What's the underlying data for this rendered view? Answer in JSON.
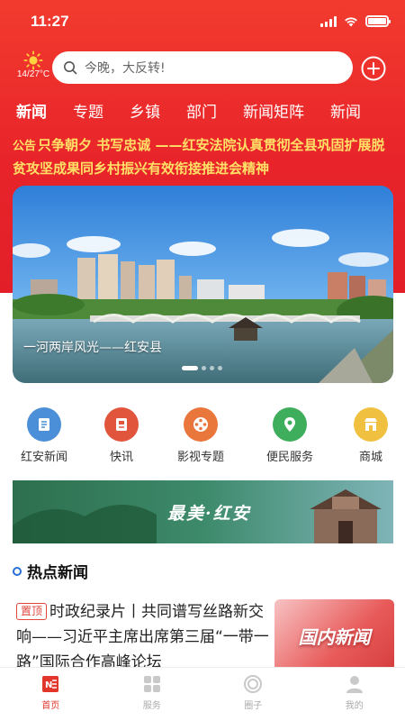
{
  "status_bar": {
    "time": "11:27"
  },
  "weather": {
    "temp": "14/27°C"
  },
  "search": {
    "placeholder": "今晚，大反转!"
  },
  "tabs": [
    {
      "label": "新闻",
      "active": true
    },
    {
      "label": "专题",
      "active": false
    },
    {
      "label": "乡镇",
      "active": false
    },
    {
      "label": "部门",
      "active": false
    },
    {
      "label": "新闻矩阵",
      "active": false
    },
    {
      "label": "新闻",
      "active": false
    }
  ],
  "ticker": {
    "tag": "公告",
    "text": "只争朝夕 书写忠诚 ——红安法院认真贯彻全县巩固扩展脱贫攻坚成果同乡村振兴有效衔接推进会精神"
  },
  "banner": {
    "caption": "一河两岸风光——红安县",
    "active_index": 0,
    "count": 4
  },
  "quick_links": [
    {
      "label": "红安新闻",
      "icon": "newspaper-icon",
      "color": "#4a8fd8"
    },
    {
      "label": "快讯",
      "icon": "flash-news-icon",
      "color": "#e0553c"
    },
    {
      "label": "影视专题",
      "icon": "film-reel-icon",
      "color": "#e9773b"
    },
    {
      "label": "便民服务",
      "icon": "location-pin-icon",
      "color": "#3fae5c"
    },
    {
      "label": "商城",
      "icon": "shop-icon",
      "color": "#f0c040"
    }
  ],
  "promo": {
    "title": "最美·红安"
  },
  "hot_news": {
    "section_title": "热点新闻",
    "items": [
      {
        "pin": "置顶",
        "title": "时政纪录片丨共同谱写丝路新交响——习近平主席出席第三届“一带一路”国际合作高峰论坛",
        "thumb_text": "国内新闻"
      }
    ]
  },
  "bottom_nav": [
    {
      "label": "首页",
      "icon": "home-news-icon",
      "active": true
    },
    {
      "label": "服务",
      "icon": "grid-services-icon",
      "active": false
    },
    {
      "label": "圈子",
      "icon": "circle-community-icon",
      "active": false
    },
    {
      "label": "我的",
      "icon": "user-profile-icon",
      "active": false
    }
  ],
  "colors": {
    "brand_red": "#e8242a",
    "ticker_yellow": "#ffe066",
    "accent_blue": "#2b6fd6"
  }
}
